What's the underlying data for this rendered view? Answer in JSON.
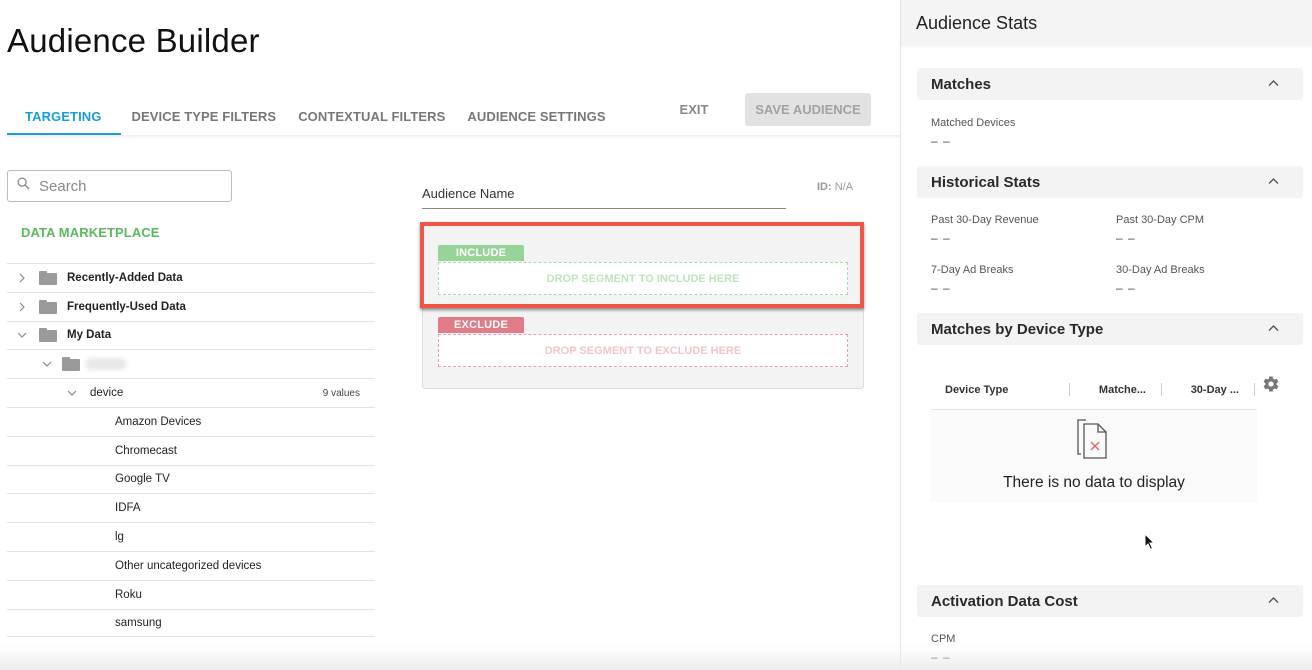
{
  "page": {
    "title": "Audience Builder"
  },
  "tabs": [
    {
      "label": "TARGETING",
      "active": true
    },
    {
      "label": "DEVICE TYPE FILTERS",
      "active": false
    },
    {
      "label": "CONTEXTUAL FILTERS",
      "active": false
    },
    {
      "label": "AUDIENCE SETTINGS",
      "active": false
    }
  ],
  "toolbar": {
    "exit_label": "EXIT",
    "save_label": "SAVE AUDIENCE"
  },
  "search": {
    "placeholder": "Search",
    "value": ""
  },
  "sidebar": {
    "marketplace_label": "DATA MARKETPLACE",
    "tree": [
      {
        "label": "Recently-Added Data",
        "expanded": false,
        "type": "folder"
      },
      {
        "label": "Frequently-Used Data",
        "expanded": false,
        "type": "folder"
      },
      {
        "label": "My Data",
        "expanded": true,
        "type": "folder"
      },
      {
        "label": "",
        "expanded": true,
        "type": "folder",
        "redacted": true
      },
      {
        "label": "device",
        "expanded": true,
        "type": "category",
        "count_label": "9 values"
      }
    ],
    "values": [
      "Amazon Devices",
      "Chromecast",
      "Google TV",
      "IDFA",
      "lg",
      "Other uncategorized devices",
      "Roku",
      "samsung"
    ]
  },
  "builder": {
    "audience_name_label": "Audience Name",
    "id_label": "ID:",
    "id_value": "N/A",
    "include_tag": "INCLUDE",
    "include_drop": "DROP SEGMENT TO INCLUDE HERE",
    "exclude_tag": "EXCLUDE",
    "exclude_drop": "DROP SEGMENT TO EXCLUDE HERE",
    "colors": {
      "include": "#97d497",
      "exclude": "#e07c88",
      "highlight": "#f05545"
    }
  },
  "stats": {
    "title": "Audience Stats",
    "matches": {
      "title": "Matches",
      "matched_devices_label": "Matched Devices",
      "matched_devices_value": "– –"
    },
    "historical": {
      "title": "Historical Stats",
      "revenue_label": "Past 30-Day Revenue",
      "revenue_value": "– –",
      "cpm_label": "Past 30-Day CPM",
      "cpm_value": "– –",
      "ad7_label": "7-Day Ad Breaks",
      "ad7_value": "– –",
      "ad30_label": "30-Day Ad Breaks",
      "ad30_value": "– –"
    },
    "by_device": {
      "title": "Matches by Device Type",
      "columns": [
        "Device Type",
        "Matche...",
        "30-Day ..."
      ],
      "empty_text": "There is no data to display"
    },
    "activation": {
      "title": "Activation Data Cost",
      "cpm_label": "CPM",
      "cpm_value": "– –"
    }
  },
  "theme": {
    "accent": "#1a9fdb",
    "marketplace": "#5cb85c"
  }
}
